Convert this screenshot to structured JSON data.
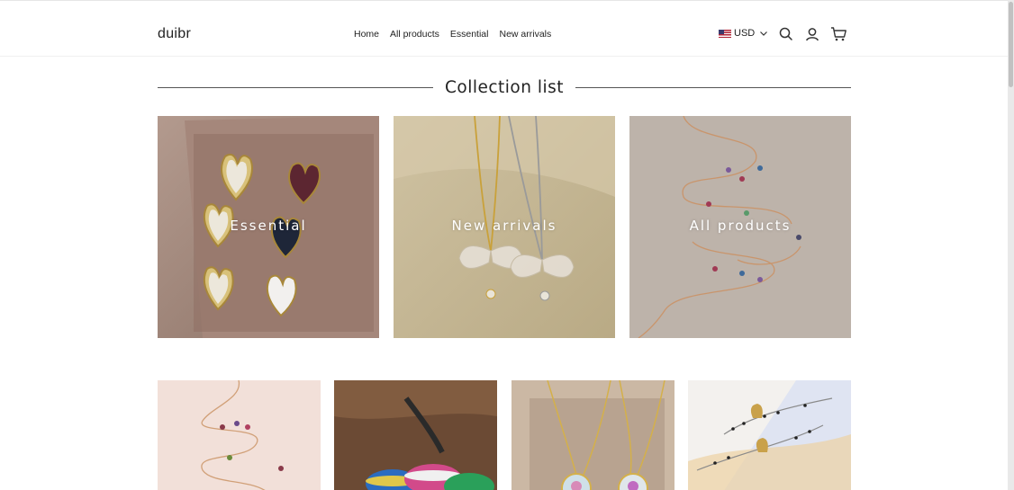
{
  "header": {
    "logo": "duibr",
    "nav": [
      "Home",
      "All products",
      "Essential",
      "New arrivals"
    ],
    "currency": "USD",
    "icons": [
      "search-icon",
      "account-icon",
      "cart-icon"
    ]
  },
  "section": {
    "title": "Collection list"
  },
  "collections": [
    {
      "label": "Essential",
      "image": "heart-earrings"
    },
    {
      "label": "New arrivals",
      "image": "butterfly-necklaces"
    },
    {
      "label": "All products",
      "image": "charm-chain"
    }
  ],
  "products": [
    {
      "image": "charm-anklet"
    },
    {
      "image": "rainbow-rings"
    },
    {
      "image": "flower-pendants"
    },
    {
      "image": "hamsa-bracelets"
    }
  ],
  "colors": {
    "text": "#222222",
    "overlay_text": "#ffffff",
    "divider": "#555555"
  }
}
